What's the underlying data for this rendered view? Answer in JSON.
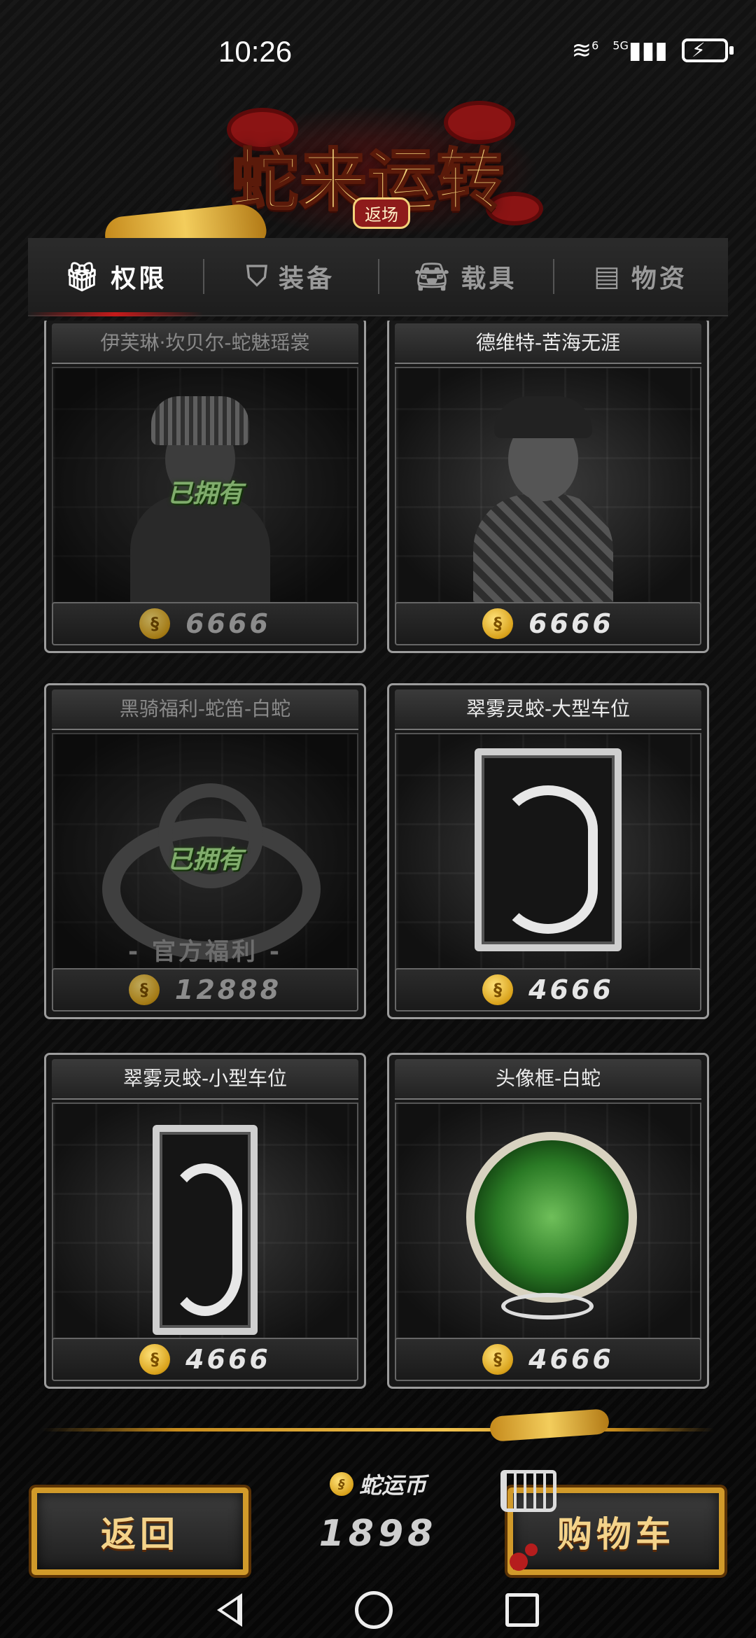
{
  "status_bar": {
    "time": "10:26",
    "wifi_label": "6",
    "network_label": "5G"
  },
  "header": {
    "title": "蛇来运转",
    "subtitle": "返场"
  },
  "tabs": [
    {
      "label": "权限",
      "icon": "gift-box-icon",
      "active": true
    },
    {
      "label": "装备",
      "icon": "shield-icon",
      "active": false
    },
    {
      "label": "载具",
      "icon": "car-icon",
      "active": false
    },
    {
      "label": "物资",
      "icon": "crate-icon",
      "active": false
    }
  ],
  "items": [
    {
      "name": "伊芙琳·坎贝尔-蛇魅瑶裳",
      "price": "6666",
      "owned_label": "已拥有",
      "owned": true
    },
    {
      "name": "德维特-苦海无涯",
      "price": "6666",
      "owned": false
    },
    {
      "name": "黑骑福利-蛇笛-白蛇",
      "price": "12888",
      "owned_label": "已拥有",
      "badge": "- 官方福利 -",
      "owned": true
    },
    {
      "name": "翠雾灵蛟-大型车位",
      "price": "4666",
      "owned": false
    },
    {
      "name": "翠雾灵蛟-小型车位",
      "price": "4666",
      "owned": false
    },
    {
      "name": "头像框-白蛇",
      "price": "4666",
      "owned": false
    }
  ],
  "footer": {
    "back_label": "返回",
    "cart_label": "购物车",
    "currency_title": "蛇运币",
    "currency_amount": "1898"
  },
  "colors": {
    "gold": "#f0c24e",
    "active_tab_red": "#c51a1a",
    "owned_green": "#b7f59a"
  }
}
